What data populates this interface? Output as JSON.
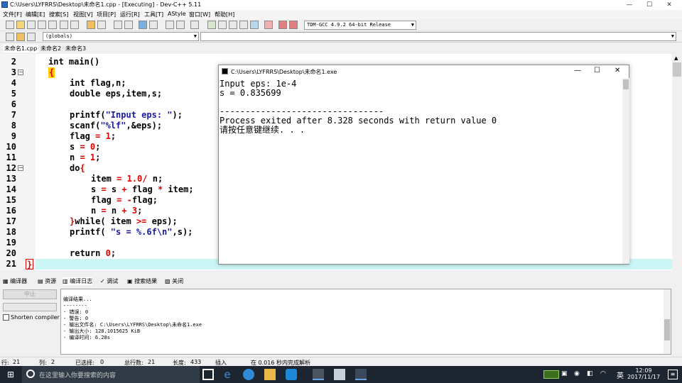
{
  "window": {
    "title": "C:\\Users\\LYFRRS\\Desktop\\未命名1.cpp - [Executing] - Dev-C++ 5.11",
    "minimize": "—",
    "maximize": "☐",
    "close": "✕"
  },
  "menu": [
    "文件[F]",
    "编辑[E]",
    "搜索[S]",
    "视图[V]",
    "项目[P]",
    "运行[R]",
    "工具[T]",
    "AStyle",
    "窗口[W]",
    "帮助[H]"
  ],
  "toolbar": {
    "compiler": "TDM-GCC 4.9.2 64-bit Release",
    "scope": "(globals)"
  },
  "file_tabs": [
    "未命名1.cpp",
    "未命名2",
    "未命名3"
  ],
  "editor": {
    "line_numbers": [
      "2",
      "3",
      "4",
      "5",
      "6",
      "7",
      "8",
      "9",
      "10",
      "11",
      "12",
      "13",
      "14",
      "15",
      "16",
      "17",
      "18",
      "19",
      "20",
      "21"
    ],
    "fold_markers": {
      "3": "−",
      "12": "−"
    }
  },
  "console": {
    "title": "C:\\Users\\LYFRRS\\Desktop\\未命名1.exe",
    "lines": [
      "Input eps: 1e-4",
      "s = 0.835699",
      "",
      "--------------------------------",
      "Process exited after 8.328 seconds with return value 0",
      "请按任意键继续. . ."
    ],
    "minimize": "—",
    "maximize": "☐",
    "close": "✕"
  },
  "panel_tabs": [
    "编译器",
    "资源",
    "编译日志",
    "调试",
    "搜索结果",
    "关闭"
  ],
  "panel": {
    "abort_button": "中止",
    "shorten_checkbox": "Shorten compiler pa",
    "log_lines": [
      "编译结果...",
      "--------",
      "- 错误: 0",
      "- 警告: 0",
      "- 输出文件名: C:\\Users\\LYFRRS\\Desktop\\未命名1.exe",
      "- 输出大小: 128.1015625 KiB",
      "- 编译时间: 6.28s"
    ]
  },
  "status": {
    "row_label": "行:",
    "row": "21",
    "col_label": "列:",
    "col": "2",
    "selected_label": "已选择:",
    "selected": "0",
    "total_label": "总行数:",
    "total": "21",
    "length_label": "长度:",
    "length": "433",
    "mode": "插入",
    "parse": "在 0.016 秒内完成解析"
  },
  "taskbar": {
    "search_placeholder": "在这里输入你要搜索的内容",
    "time": "12:09",
    "date": "2017/11/17",
    "ime": "英"
  },
  "colors": {
    "string": "#1a1aa6",
    "number_operator": "#e00000",
    "current_line": "#ccf6f6",
    "taskbar": "#1c2530"
  }
}
